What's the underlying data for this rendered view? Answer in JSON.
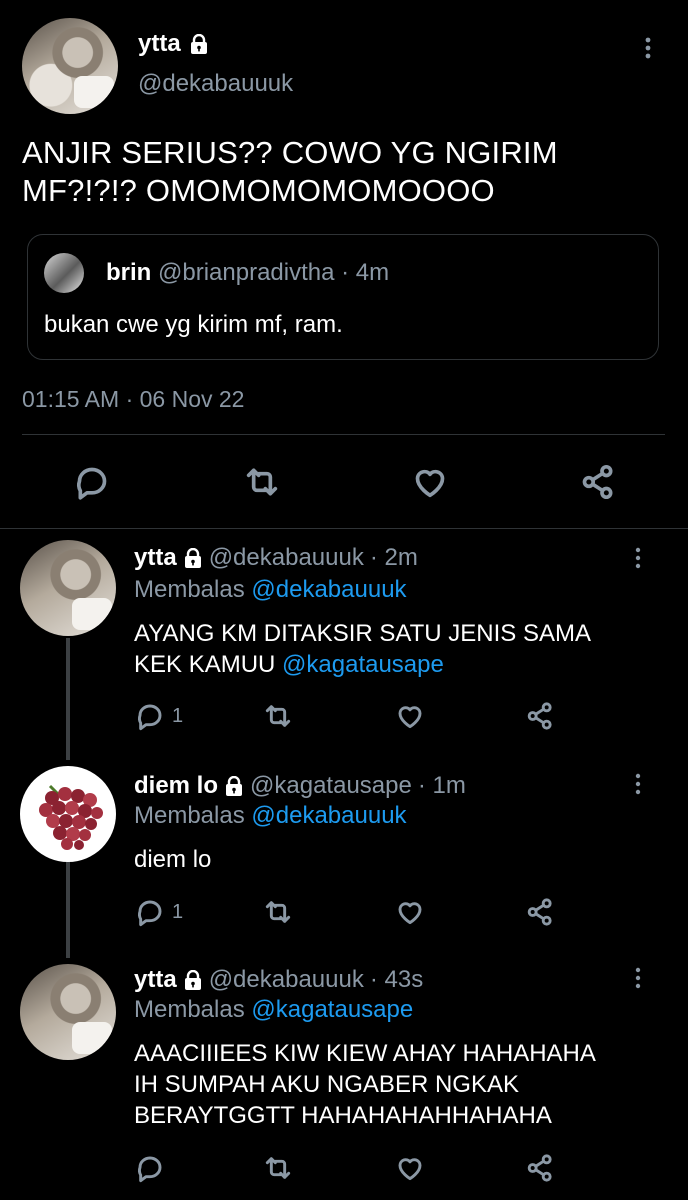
{
  "main_tweet": {
    "author_name": "ytta",
    "author_handle": "@dekabauuuk",
    "text_lines": [
      "ANJIR SERIUS?? COWO YG NGIRIM",
      "MF?!?!? OMOMOMOMOMOOOO"
    ],
    "quoted": {
      "author_name": "brin",
      "author_handle": "@brianpradivtha",
      "time": "· 4m",
      "text": "bukan cwe yg kirim mf, ram."
    },
    "timestamp": "01:15 AM · 06 Nov 22",
    "icons": [
      "reply-icon",
      "retweet-icon",
      "like-icon",
      "share-icon"
    ]
  },
  "replies": [
    {
      "author_name": "ytta",
      "author_handle": "@dekabauuuk",
      "time": "· 2m",
      "replying_prefix": "Membalas",
      "replying_to": "@dekabauuuk",
      "text_lines": [
        "AYANG KM DITAKSIR SATU JENIS SAMA"
      ],
      "text_line2_prefix": "KEK KAMUU ",
      "text_line2_mention": "@kagatausape",
      "reply_count": "1"
    },
    {
      "author_name": "diem lo",
      "author_handle": "@kagatausape",
      "time": "· 1m",
      "replying_prefix": "Membalas",
      "replying_to": "@dekabauuuk",
      "text": "diem lo",
      "reply_count": "1"
    },
    {
      "author_name": "ytta",
      "author_handle": "@dekabauuuk",
      "time": "· 43s",
      "replying_prefix": "Membalas",
      "replying_to": "@kagatausape",
      "text_lines": [
        "AAACIIIEES KIW KIEW AHAY HAHAHAHA",
        "IH SUMPAH AKU NGABER NGKAK",
        "BERAYTGGTT HAHAHAHAHHAHAHA"
      ]
    }
  ],
  "colors": {
    "background": "#000000",
    "text": "#e7e9ea",
    "muted": "#8b98a5",
    "link": "#1d9bf0"
  }
}
